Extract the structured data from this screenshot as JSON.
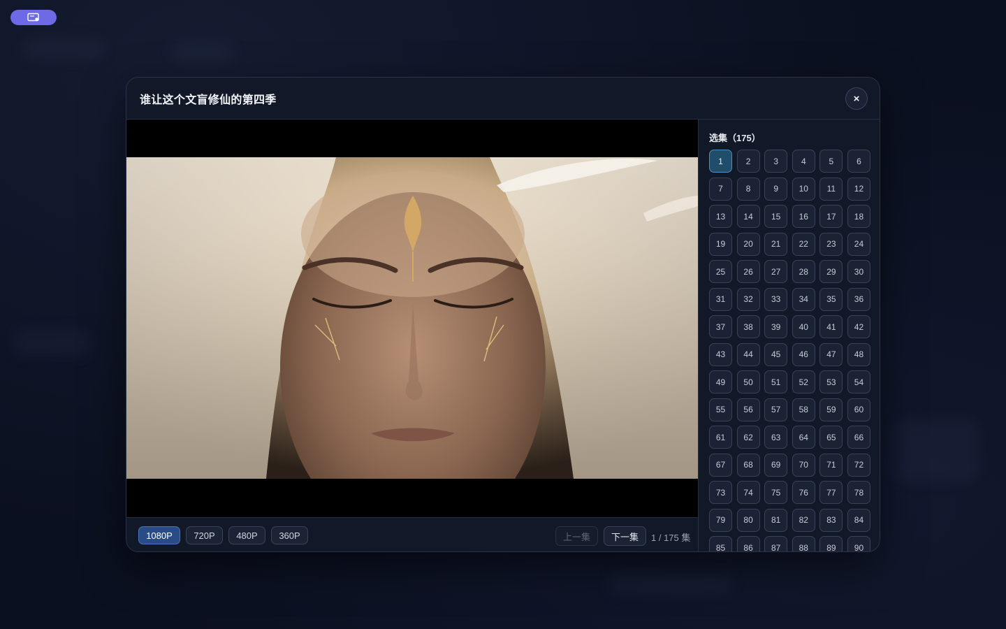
{
  "modal": {
    "title": "谁让这个文盲修仙的第四季",
    "close_label": "×"
  },
  "player": {
    "qualities": [
      {
        "label": "1080P",
        "active": true
      },
      {
        "label": "720P",
        "active": false
      },
      {
        "label": "480P",
        "active": false
      },
      {
        "label": "360P",
        "active": false
      }
    ],
    "prev_label": "上一集",
    "next_label": "下一集",
    "counter": "1 / 175 集"
  },
  "episodes": {
    "title": "选集（175）",
    "total": 175,
    "visible_count": 90,
    "current": 1
  },
  "colors": {
    "accent": "#2a4c86",
    "active_episode": "#1f4d6a",
    "badge": "#6e6ae6"
  }
}
